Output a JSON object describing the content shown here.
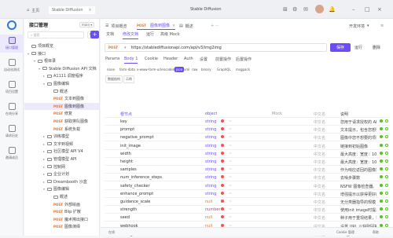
{
  "titlebar": {
    "home": "主页",
    "project_tab": "Stable Diffusion",
    "project_title": "Stable Diffusion",
    "env": "开发环境",
    "user_badge": "1"
  },
  "rail": {
    "items": [
      {
        "label": "接口管理"
      },
      {
        "label": "自动化测试"
      },
      {
        "label": "项目设置"
      },
      {
        "label": "在线分享"
      },
      {
        "label": "请求历史"
      },
      {
        "label": "邀请成员"
      }
    ]
  },
  "tree": {
    "title": "接口管理",
    "branch": "main",
    "search_placeholder": "搜索",
    "items": [
      {
        "label": "项目概览",
        "method": "",
        "indent": 0,
        "caret": "",
        "icon": "overview-icon"
      },
      {
        "label": "接口",
        "method": "",
        "indent": 0,
        "caret": "▾",
        "icon": "folder-icon"
      },
      {
        "label": "根目录",
        "method": "",
        "indent": 8,
        "caret": "▾",
        "icon": "folder-icon"
      },
      {
        "label": "Stable Diffusion API 文档",
        "method": "",
        "indent": 14,
        "caret": "▾",
        "icon": "folder-icon"
      },
      {
        "label": "A1111 调度程序",
        "method": "",
        "indent": 20,
        "caret": "▸",
        "icon": "folder-icon"
      },
      {
        "label": "图像编辑",
        "method": "",
        "indent": 20,
        "caret": "▾",
        "icon": "folder-icon"
      },
      {
        "label": "概述",
        "method": "",
        "indent": 28,
        "caret": "",
        "icon": "doc-icon"
      },
      {
        "label": "文本到图像",
        "method": "POST",
        "indent": 28,
        "caret": "",
        "icon": ""
      },
      {
        "label": "图像到图像",
        "method": "POST",
        "indent": 28,
        "caret": "",
        "icon": "",
        "selected": true
      },
      {
        "label": "修复",
        "method": "POST",
        "indent": 28,
        "caret": "",
        "icon": ""
      },
      {
        "label": "获取排队图像",
        "method": "POST",
        "indent": 28,
        "caret": "",
        "icon": ""
      },
      {
        "label": "系统负载",
        "method": "POST",
        "indent": 28,
        "caret": "",
        "icon": ""
      },
      {
        "label": "训练模型",
        "method": "",
        "indent": 20,
        "caret": "▸",
        "icon": "folder-icon"
      },
      {
        "label": "文字到视频",
        "method": "",
        "indent": 20,
        "caret": "▸",
        "icon": "folder-icon"
      },
      {
        "label": "社区模型 API V4",
        "method": "",
        "indent": 20,
        "caret": "▸",
        "icon": "folder-icon"
      },
      {
        "label": "管理模型 API",
        "method": "",
        "indent": 20,
        "caret": "▸",
        "icon": "folder-icon"
      },
      {
        "label": "控制网",
        "method": "",
        "indent": 20,
        "caret": "▸",
        "icon": "folder-icon"
      },
      {
        "label": "企业计划",
        "method": "",
        "indent": 20,
        "caret": "▸",
        "icon": "folder-icon"
      },
      {
        "label": "Dreambooth 沙盒",
        "method": "",
        "indent": 20,
        "caret": "▸",
        "icon": "folder-icon"
      },
      {
        "label": "图像编辑",
        "method": "",
        "indent": 20,
        "caret": "▾",
        "icon": "folder-icon"
      },
      {
        "label": "概述",
        "method": "",
        "indent": 28,
        "caret": "",
        "icon": "doc-icon"
      },
      {
        "label": "外部绘画",
        "method": "POST",
        "indent": 28,
        "caret": "",
        "icon": ""
      },
      {
        "label": "Blip 扩散",
        "method": "POST",
        "indent": 28,
        "caret": "",
        "icon": ""
      },
      {
        "label": "魔术擦出接口",
        "method": "POST",
        "indent": 28,
        "caret": "",
        "icon": ""
      },
      {
        "label": "图像演绎",
        "method": "POST",
        "indent": 28,
        "caret": "",
        "icon": ""
      }
    ]
  },
  "main": {
    "tabs": [
      {
        "label": "项目概览",
        "method": ""
      },
      {
        "label": "图像到图像",
        "method": "POST"
      },
      {
        "label": "概述",
        "method": ""
      }
    ],
    "subtabs": [
      "文档",
      "修改文档",
      "运行",
      "高级 Mock"
    ],
    "method": "POST",
    "url": "https://stablediffusionapi.com/api/v3/img2img",
    "save_label": "保存",
    "run_label": "运行",
    "delete_label": "删除",
    "param_tabs": [
      "Params",
      "Body",
      "Cookie",
      "Header",
      "Auth",
      "设置",
      "前置操作",
      "后置操作"
    ],
    "body_count": "1",
    "content_types": [
      "none",
      "form-data",
      "x-www-form-urlencoded",
      "json",
      "xml",
      "raw",
      "binary",
      "GraphQL",
      "msgpack"
    ],
    "chips": [
      "数据结构",
      "示例"
    ],
    "root_label": "根节点",
    "root_type": "object",
    "root_mock": "Mock",
    "root_req": "中文名",
    "root_desc": "说明",
    "fields": [
      {
        "name": "key",
        "type": "string",
        "mock": "",
        "req": "中文名",
        "desc": "您用于请求授权的 API k"
      },
      {
        "name": "prompt",
        "type": "string",
        "mock": "",
        "req": "中文名",
        "desc": "文本提示，包含您想要在"
      },
      {
        "name": "negative_prompt",
        "type": "string",
        "mock": "",
        "req": "中文名",
        "desc": "图像中您不想要的项目"
      },
      {
        "name": "init_image",
        "type": "string",
        "mock": "",
        "req": "中文名",
        "desc": "链接到初始图像"
      },
      {
        "name": "width",
        "type": "string",
        "mock": "",
        "req": "中文名",
        "desc": "最大高度：宽度：1024"
      },
      {
        "name": "height",
        "type": "string",
        "mock": "",
        "req": "中文名",
        "desc": "最大高度：宽度：1024"
      },
      {
        "name": "samples",
        "type": "string",
        "mock": "",
        "req": "中文名",
        "desc": "作为响应返回的图像数量"
      },
      {
        "name": "num_inference_steps",
        "type": "string",
        "mock": "",
        "req": "中文名",
        "desc": "去噪步骤数"
      },
      {
        "name": "safety_checker",
        "type": "string",
        "mock": "",
        "req": "中文名",
        "desc": "NSFW 图像检查器。如果"
      },
      {
        "name": "enhance_prompt",
        "type": "string",
        "mock": "",
        "req": "中文名",
        "desc": "增强提示以获得更好的结果"
      },
      {
        "name": "guidance_scale",
        "type": "null",
        "mock": "",
        "req": "中文名",
        "desc": "无分类器指导的规模"
      },
      {
        "name": "strength",
        "type": "number",
        "mock": "",
        "req": "中文名",
        "desc": "使用init image时提示强"
      },
      {
        "name": "seed",
        "type": "null",
        "mock": "",
        "req": "中文名",
        "desc": "种子用于重现结果，相同"
      },
      {
        "name": "webhook",
        "type": "null",
        "mock": "",
        "req": "中文名",
        "desc": "设置 URL 以获取回答"
      },
      {
        "name": "track_id",
        "type": "null",
        "mock": "",
        "req": "中文名",
        "desc": "ID 在 Webhook API 调"
      }
    ],
    "mock_hint": "~"
  },
  "status": {
    "left": "在线",
    "center": "Cookie 管理",
    "right": "帮助"
  },
  "colors": {
    "accent": "#6b4cf6",
    "post": "#e8702a",
    "required_dot": "#ff4d4f",
    "ok_dot": "#52c41a"
  }
}
